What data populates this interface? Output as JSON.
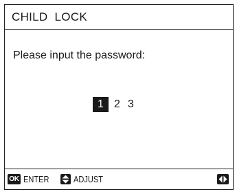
{
  "header": {
    "title": "CHILD  LOCK"
  },
  "main": {
    "prompt": "Please input the password:",
    "password_digits": [
      {
        "value": "1",
        "selected": true
      },
      {
        "value": "2",
        "selected": false
      },
      {
        "value": "3",
        "selected": false
      }
    ]
  },
  "footer": {
    "ok_key_label": "OK",
    "enter_label": "ENTER",
    "adjust_label": "ADJUST",
    "icons": {
      "ok": "ok-key-icon",
      "adjust": "up-down-arrow-icon",
      "navigate": "left-right-arrow-icon"
    }
  }
}
